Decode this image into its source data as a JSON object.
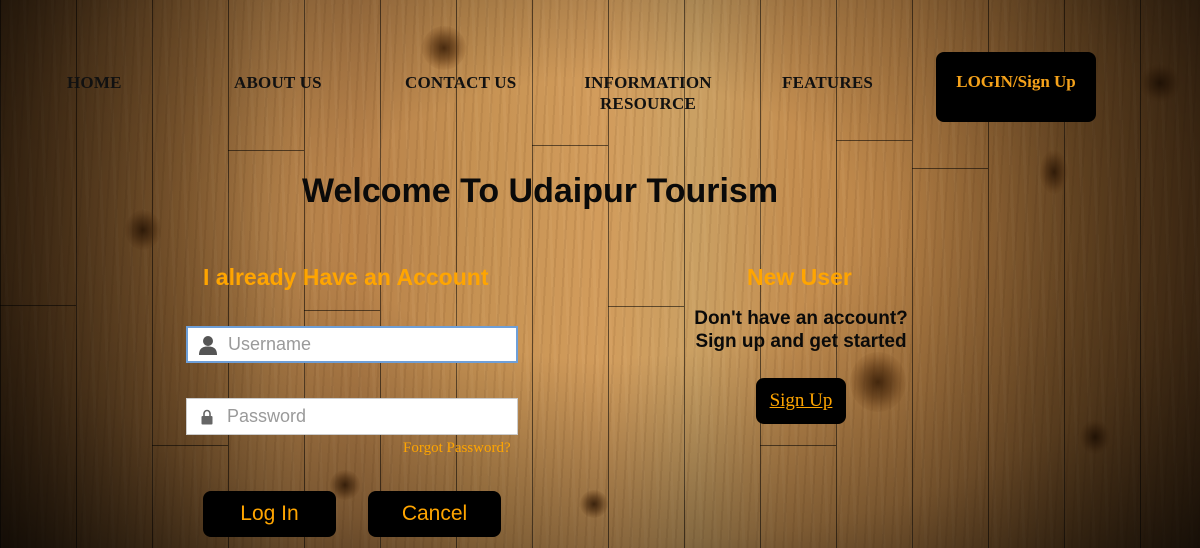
{
  "nav": {
    "home": "HOME",
    "about": "ABOUT US",
    "contact": "CONTACT US",
    "info_line1": "INFORMATION",
    "info_line2": "RESOURCE",
    "features": "FEATURES",
    "login_signup": "LOGIN/Sign Up"
  },
  "page": {
    "title": "Welcome To Udaipur Tourism"
  },
  "login": {
    "heading": "I already Have an Account",
    "username_placeholder": "Username",
    "username_value": "",
    "password_placeholder": "Password",
    "password_value": "",
    "forgot_label": "Forgot Password?",
    "login_button": "Log In",
    "cancel_button": "Cancel",
    "username_icon": "user-icon",
    "password_icon": "lock-icon"
  },
  "new_user": {
    "heading": "New User",
    "line1": "Don't have an account?",
    "line2": "Sign up and get started",
    "signup_button": "Sign Up"
  },
  "colors": {
    "accent": "#ffa500",
    "button_bg": "#000000",
    "heading_text": "#0a0a0a"
  }
}
